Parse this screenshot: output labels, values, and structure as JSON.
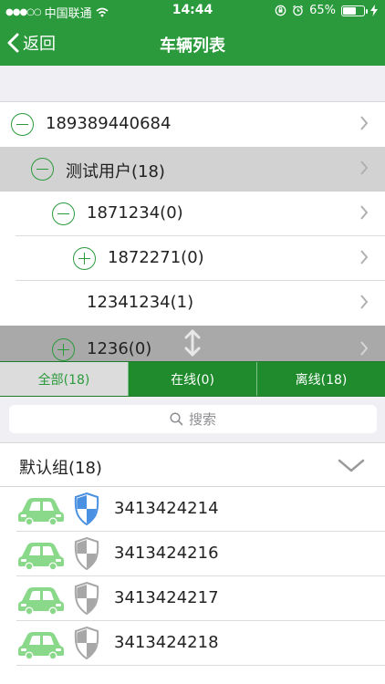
{
  "status": {
    "carrier": "中国联通",
    "time": "14:44",
    "battery": "65%",
    "battery_level": 0.65
  },
  "nav": {
    "back_label": "返回",
    "title": "车辆列表"
  },
  "tree": {
    "rows": [
      {
        "label": "189389440684",
        "expand": "minus"
      },
      {
        "label": "测试用户(18)",
        "expand": "minus"
      },
      {
        "label": "1871234(0)",
        "expand": "minus"
      },
      {
        "label": "1872271(0)",
        "expand": "plus"
      },
      {
        "label": "12341234(1)",
        "expand": "none"
      },
      {
        "label": "1236(0)",
        "expand": "plus"
      }
    ]
  },
  "tabs": {
    "all": "全部(18)",
    "online": "在线(0)",
    "offline": "离线(18)",
    "active": "all"
  },
  "search": {
    "placeholder": "搜索"
  },
  "group": {
    "title": "默认组(18)"
  },
  "vehicles": [
    {
      "id": "3413424214",
      "shield": "blue"
    },
    {
      "id": "3413424216",
      "shield": "gray"
    },
    {
      "id": "3413424217",
      "shield": "gray"
    },
    {
      "id": "3413424218",
      "shield": "gray"
    }
  ],
  "colors": {
    "brand_green": "#2a9a3c",
    "tab_green": "#1f8b2d",
    "car_green": "#8ad88a",
    "shield_blue": "#4a90e2",
    "shield_gray": "#a7a7a7"
  }
}
